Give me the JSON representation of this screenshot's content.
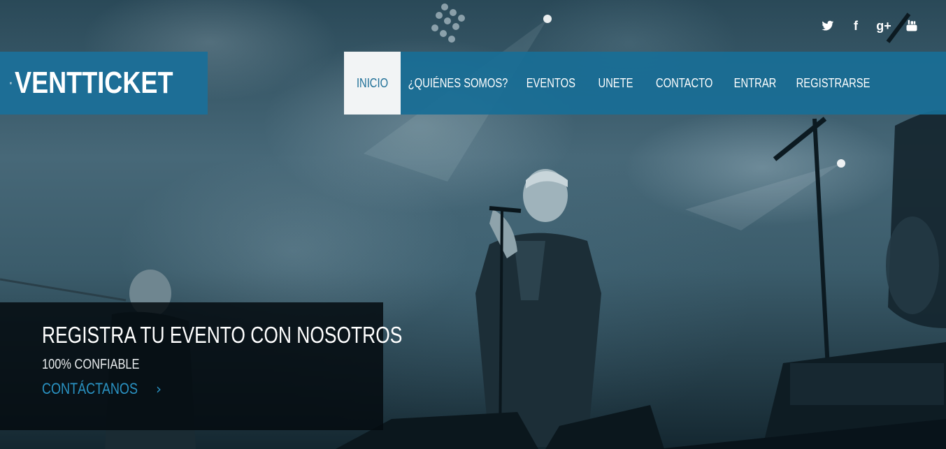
{
  "brand": {
    "name": "VENTTICKET",
    "color": "#1d6e96"
  },
  "social": [
    {
      "name": "twitter-icon"
    },
    {
      "name": "facebook-icon",
      "glyph": "f"
    },
    {
      "name": "google-plus-icon",
      "glyph": "g+"
    },
    {
      "name": "youtube-icon"
    }
  ],
  "nav": {
    "items": [
      {
        "label": "INICIO",
        "active": true
      },
      {
        "label": "¿QUIÉNES SOMOS?",
        "active": false
      },
      {
        "label": "EVENTOS",
        "active": false
      },
      {
        "label": "UNETE",
        "active": false
      },
      {
        "label": "CONTACTO",
        "active": false
      },
      {
        "label": "ENTRAR",
        "active": false
      },
      {
        "label": "REGISTRARSE",
        "active": false
      }
    ]
  },
  "hero": {
    "title": "REGISTRA TU EVENTO CON NOSOTROS",
    "subtitle": "100% CONFIABLE",
    "cta_label": "CONTÁCTANOS",
    "cta_icon": "chevron-right-icon"
  },
  "colors": {
    "accent": "#1d6e96",
    "link": "#2a93c4"
  }
}
